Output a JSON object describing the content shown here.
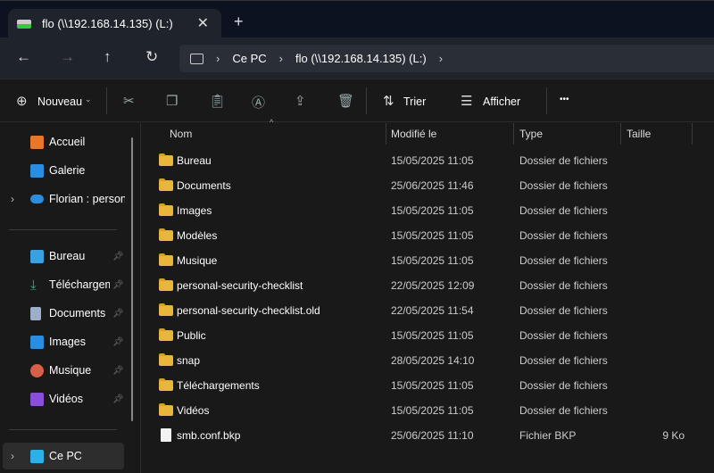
{
  "tab": {
    "title": "flo (\\\\192.168.14.135) (L:)",
    "close": "✕",
    "new": "+"
  },
  "nav": {
    "back": "←",
    "forward": "→",
    "up": "↑",
    "refresh": "↻",
    "breadcrumb": [
      "Ce PC",
      "flo (\\\\192.168.14.135) (L:)"
    ],
    "sep": "›"
  },
  "toolbar": {
    "new": "Nouveau",
    "sort": "Trier",
    "view": "Afficher",
    "more": "•••"
  },
  "sidebar": {
    "top": [
      {
        "label": "Accueil",
        "color": "#e8762b"
      },
      {
        "label": "Galerie",
        "color": "#2b8de0"
      },
      {
        "label": "Florian : personnel",
        "color": "#2b8de0",
        "expand": "›"
      }
    ],
    "pinned": [
      {
        "label": "Bureau",
        "color": "#3aa0e0"
      },
      {
        "label": "Téléchargements",
        "color": "#2fb58c"
      },
      {
        "label": "Documents",
        "color": "#9bb0c8"
      },
      {
        "label": "Images",
        "color": "#2b8de0"
      },
      {
        "label": "Musique",
        "color": "#d8604a"
      },
      {
        "label": "Vidéos",
        "color": "#8a4fd8"
      }
    ],
    "pc": {
      "label": "Ce PC",
      "expand": "›"
    }
  },
  "columns": {
    "name": "Nom",
    "modified": "Modifié le",
    "type": "Type",
    "size": "Taille"
  },
  "files": [
    {
      "name": "Bureau",
      "modified": "15/05/2025 11:05",
      "type": "Dossier de fichiers",
      "size": ""
    },
    {
      "name": "Documents",
      "modified": "25/06/2025 11:46",
      "type": "Dossier de fichiers",
      "size": ""
    },
    {
      "name": "Images",
      "modified": "15/05/2025 11:05",
      "type": "Dossier de fichiers",
      "size": ""
    },
    {
      "name": "Modèles",
      "modified": "15/05/2025 11:05",
      "type": "Dossier de fichiers",
      "size": ""
    },
    {
      "name": "Musique",
      "modified": "15/05/2025 11:05",
      "type": "Dossier de fichiers",
      "size": ""
    },
    {
      "name": "personal-security-checklist",
      "modified": "22/05/2025 12:09",
      "type": "Dossier de fichiers",
      "size": ""
    },
    {
      "name": "personal-security-checklist.old",
      "modified": "22/05/2025 11:54",
      "type": "Dossier de fichiers",
      "size": ""
    },
    {
      "name": "Public",
      "modified": "15/05/2025 11:05",
      "type": "Dossier de fichiers",
      "size": ""
    },
    {
      "name": "snap",
      "modified": "28/05/2025 14:10",
      "type": "Dossier de fichiers",
      "size": ""
    },
    {
      "name": "Téléchargements",
      "modified": "15/05/2025 11:05",
      "type": "Dossier de fichiers",
      "size": ""
    },
    {
      "name": "Vidéos",
      "modified": "15/05/2025 11:05",
      "type": "Dossier de fichiers",
      "size": ""
    },
    {
      "name": "smb.conf.bkp",
      "modified": "25/06/2025 11:10",
      "type": "Fichier BKP",
      "size": "9 Ko",
      "file": true
    }
  ]
}
